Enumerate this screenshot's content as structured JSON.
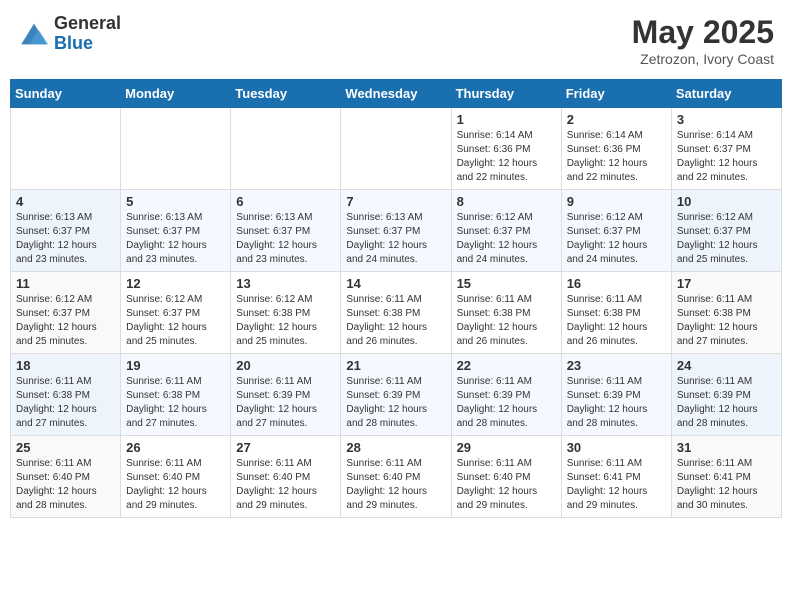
{
  "header": {
    "logo_general": "General",
    "logo_blue": "Blue",
    "month": "May 2025",
    "location": "Zetrozon, Ivory Coast"
  },
  "days_of_week": [
    "Sunday",
    "Monday",
    "Tuesday",
    "Wednesday",
    "Thursday",
    "Friday",
    "Saturday"
  ],
  "weeks": [
    [
      {
        "day": "",
        "info": ""
      },
      {
        "day": "",
        "info": ""
      },
      {
        "day": "",
        "info": ""
      },
      {
        "day": "",
        "info": ""
      },
      {
        "day": "1",
        "info": "Sunrise: 6:14 AM\nSunset: 6:36 PM\nDaylight: 12 hours and 22 minutes."
      },
      {
        "day": "2",
        "info": "Sunrise: 6:14 AM\nSunset: 6:36 PM\nDaylight: 12 hours and 22 minutes."
      },
      {
        "day": "3",
        "info": "Sunrise: 6:14 AM\nSunset: 6:37 PM\nDaylight: 12 hours and 22 minutes."
      }
    ],
    [
      {
        "day": "4",
        "info": "Sunrise: 6:13 AM\nSunset: 6:37 PM\nDaylight: 12 hours and 23 minutes."
      },
      {
        "day": "5",
        "info": "Sunrise: 6:13 AM\nSunset: 6:37 PM\nDaylight: 12 hours and 23 minutes."
      },
      {
        "day": "6",
        "info": "Sunrise: 6:13 AM\nSunset: 6:37 PM\nDaylight: 12 hours and 23 minutes."
      },
      {
        "day": "7",
        "info": "Sunrise: 6:13 AM\nSunset: 6:37 PM\nDaylight: 12 hours and 24 minutes."
      },
      {
        "day": "8",
        "info": "Sunrise: 6:12 AM\nSunset: 6:37 PM\nDaylight: 12 hours and 24 minutes."
      },
      {
        "day": "9",
        "info": "Sunrise: 6:12 AM\nSunset: 6:37 PM\nDaylight: 12 hours and 24 minutes."
      },
      {
        "day": "10",
        "info": "Sunrise: 6:12 AM\nSunset: 6:37 PM\nDaylight: 12 hours and 25 minutes."
      }
    ],
    [
      {
        "day": "11",
        "info": "Sunrise: 6:12 AM\nSunset: 6:37 PM\nDaylight: 12 hours and 25 minutes."
      },
      {
        "day": "12",
        "info": "Sunrise: 6:12 AM\nSunset: 6:37 PM\nDaylight: 12 hours and 25 minutes."
      },
      {
        "day": "13",
        "info": "Sunrise: 6:12 AM\nSunset: 6:38 PM\nDaylight: 12 hours and 25 minutes."
      },
      {
        "day": "14",
        "info": "Sunrise: 6:11 AM\nSunset: 6:38 PM\nDaylight: 12 hours and 26 minutes."
      },
      {
        "day": "15",
        "info": "Sunrise: 6:11 AM\nSunset: 6:38 PM\nDaylight: 12 hours and 26 minutes."
      },
      {
        "day": "16",
        "info": "Sunrise: 6:11 AM\nSunset: 6:38 PM\nDaylight: 12 hours and 26 minutes."
      },
      {
        "day": "17",
        "info": "Sunrise: 6:11 AM\nSunset: 6:38 PM\nDaylight: 12 hours and 27 minutes."
      }
    ],
    [
      {
        "day": "18",
        "info": "Sunrise: 6:11 AM\nSunset: 6:38 PM\nDaylight: 12 hours and 27 minutes."
      },
      {
        "day": "19",
        "info": "Sunrise: 6:11 AM\nSunset: 6:38 PM\nDaylight: 12 hours and 27 minutes."
      },
      {
        "day": "20",
        "info": "Sunrise: 6:11 AM\nSunset: 6:39 PM\nDaylight: 12 hours and 27 minutes."
      },
      {
        "day": "21",
        "info": "Sunrise: 6:11 AM\nSunset: 6:39 PM\nDaylight: 12 hours and 28 minutes."
      },
      {
        "day": "22",
        "info": "Sunrise: 6:11 AM\nSunset: 6:39 PM\nDaylight: 12 hours and 28 minutes."
      },
      {
        "day": "23",
        "info": "Sunrise: 6:11 AM\nSunset: 6:39 PM\nDaylight: 12 hours and 28 minutes."
      },
      {
        "day": "24",
        "info": "Sunrise: 6:11 AM\nSunset: 6:39 PM\nDaylight: 12 hours and 28 minutes."
      }
    ],
    [
      {
        "day": "25",
        "info": "Sunrise: 6:11 AM\nSunset: 6:40 PM\nDaylight: 12 hours and 28 minutes."
      },
      {
        "day": "26",
        "info": "Sunrise: 6:11 AM\nSunset: 6:40 PM\nDaylight: 12 hours and 29 minutes."
      },
      {
        "day": "27",
        "info": "Sunrise: 6:11 AM\nSunset: 6:40 PM\nDaylight: 12 hours and 29 minutes."
      },
      {
        "day": "28",
        "info": "Sunrise: 6:11 AM\nSunset: 6:40 PM\nDaylight: 12 hours and 29 minutes."
      },
      {
        "day": "29",
        "info": "Sunrise: 6:11 AM\nSunset: 6:40 PM\nDaylight: 12 hours and 29 minutes."
      },
      {
        "day": "30",
        "info": "Sunrise: 6:11 AM\nSunset: 6:41 PM\nDaylight: 12 hours and 29 minutes."
      },
      {
        "day": "31",
        "info": "Sunrise: 6:11 AM\nSunset: 6:41 PM\nDaylight: 12 hours and 30 minutes."
      }
    ]
  ]
}
